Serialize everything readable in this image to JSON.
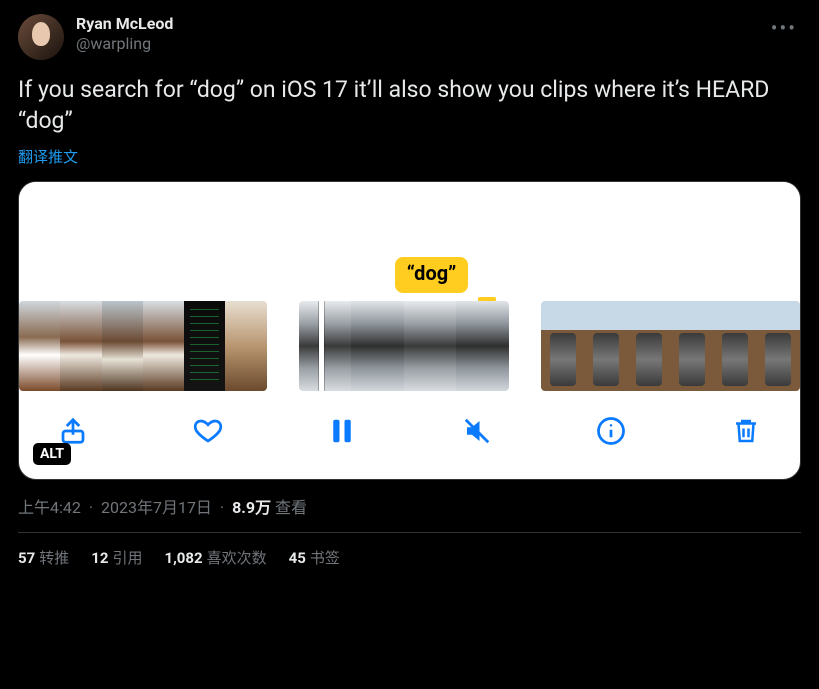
{
  "author": {
    "display_name": "Ryan McLeod",
    "handle": "@warpling"
  },
  "tweet_text": "If you search for “dog” on iOS 17 it’ll also show you clips where it’s HEARD “dog”",
  "translate_label": "翻译推文",
  "media": {
    "search_tag": "“dog”",
    "alt_badge": "ALT",
    "icons": {
      "share": "share-icon",
      "heart": "heart-icon",
      "pause": "pause-icon",
      "mute": "mute-icon",
      "info": "info-icon",
      "trash": "trash-icon"
    }
  },
  "meta": {
    "time": "上午4:42",
    "date": "2023年7月17日",
    "views_number": "8.9万",
    "views_label": "查看"
  },
  "stats": {
    "retweets": {
      "count": "57",
      "label": "转推"
    },
    "quotes": {
      "count": "12",
      "label": "引用"
    },
    "likes": {
      "count": "1,082",
      "label": "喜欢次数"
    },
    "bookmarks": {
      "count": "45",
      "label": "书签"
    }
  }
}
